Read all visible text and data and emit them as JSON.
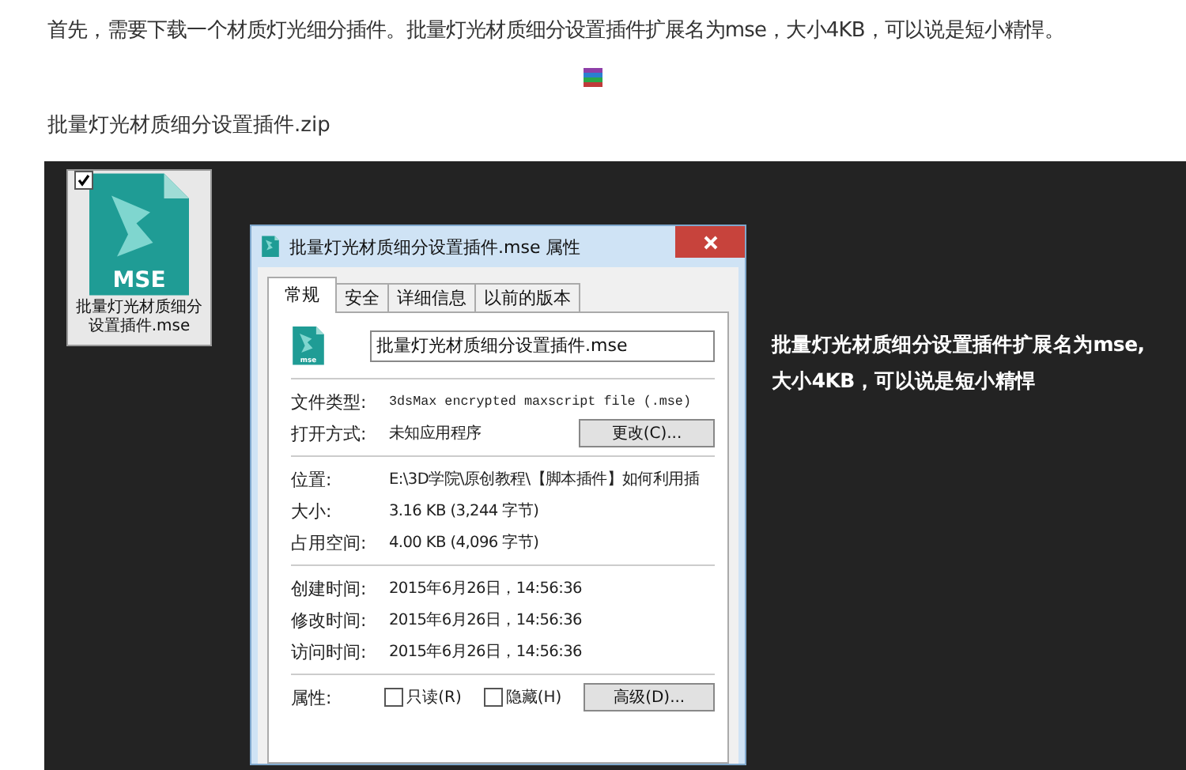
{
  "article": {
    "intro": "首先，需要下载一个材质灯光细分插件。批量灯光材质细分设置插件扩展名为mse，大小4KB，可以说是短小精悍。",
    "attachment_name": "批量灯光材质细分设置插件.zip"
  },
  "screenshot": {
    "desktop_file": {
      "icon_label": "MSE",
      "label": "批量灯光材质细分设置插件.mse",
      "checked": true
    },
    "dialog": {
      "title": "批量灯光材质细分设置插件.mse 属性",
      "tabs": [
        {
          "label": "常规",
          "selected": true
        },
        {
          "label": "安全",
          "selected": false
        },
        {
          "label": "详细信息",
          "selected": false
        },
        {
          "label": "以前的版本",
          "selected": false
        }
      ],
      "file_icon_label": "mse",
      "file_name": "批量灯光材质细分设置插件.mse",
      "groups": [
        [
          {
            "label": "文件类型:",
            "value": "3dsMax encrypted maxscript file (.mse)",
            "kind": "mono"
          },
          {
            "label": "打开方式:",
            "value": "未知应用程序",
            "kind": "button",
            "button": "更改(C)..."
          }
        ],
        [
          {
            "label": "位置:",
            "value": "E:\\3D学院\\原创教程\\【脚本插件】如何利用插",
            "kind": "text"
          },
          {
            "label": "大小:",
            "value": "3.16 KB (3,244 字节)",
            "kind": "text"
          },
          {
            "label": "占用空间:",
            "value": "4.00 KB (4,096 字节)",
            "kind": "text"
          }
        ],
        [
          {
            "label": "创建时间:",
            "value": "2015年6月26日，14:56:36",
            "kind": "text"
          },
          {
            "label": "修改时间:",
            "value": "2015年6月26日，14:56:36",
            "kind": "text"
          },
          {
            "label": "访问时间:",
            "value": "2015年6月26日，14:56:36",
            "kind": "text"
          }
        ]
      ],
      "attributes": {
        "label": "属性:",
        "checkboxes": [
          {
            "label": "只读(R)",
            "checked": false
          },
          {
            "label": "隐藏(H)",
            "checked": false
          }
        ],
        "button": "高级(D)..."
      }
    },
    "caption": [
      "批量灯光材质细分设置插件扩展名为mse,",
      "大小4KB，可以说是短小精悍"
    ]
  }
}
